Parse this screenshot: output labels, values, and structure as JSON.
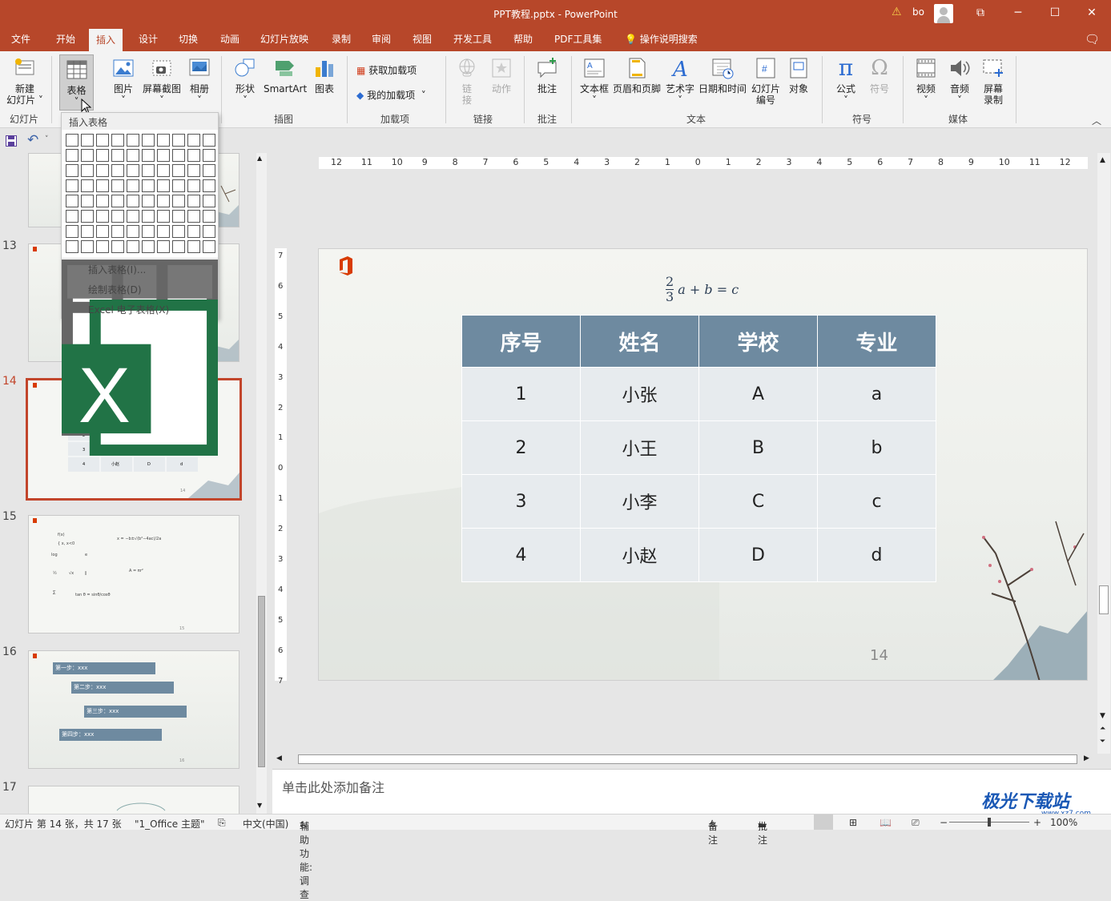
{
  "window": {
    "title": "PPT教程.pptx - PowerPoint",
    "user": "bo",
    "minimize": "─",
    "maximize": "☐",
    "close": "✕",
    "restore": "⧉"
  },
  "tabs": [
    "文件",
    "开始",
    "插入",
    "设计",
    "切换",
    "动画",
    "幻灯片放映",
    "录制",
    "审阅",
    "视图",
    "开发工具",
    "帮助",
    "PDF工具集",
    "操作说明搜索"
  ],
  "active_tab": "插入",
  "ribbon": {
    "new_slide": "新建\n幻灯片",
    "new_slide_l1": "新建",
    "new_slide_l2": "幻灯片",
    "table": "表格",
    "picture": "图片",
    "screenshot": "屏幕截图",
    "album": "相册",
    "shapes": "形状",
    "smartart": "SmartArt",
    "chart": "图表",
    "get_addins": "获取加载项",
    "my_addins": "我的加载项",
    "link": "链接",
    "link_l1": "链",
    "link_l2": "接",
    "action": "动作",
    "comment": "批注",
    "textbox": "文本框",
    "header_footer": "页眉和页脚",
    "wordart": "艺术字",
    "datetime": "日期和时间",
    "slide_num_l1": "幻灯片",
    "slide_num_l2": "编号",
    "object": "对象",
    "equation": "公式",
    "symbol": "符号",
    "video": "视频",
    "audio": "音频",
    "screen_rec_l1": "屏幕",
    "screen_rec_l2": "录制",
    "groups": {
      "slides": "幻灯片",
      "illustrations": "插图",
      "addins": "加载项",
      "links": "链接",
      "comments": "批注",
      "text": "文本",
      "symbols": "符号",
      "media": "媒体"
    }
  },
  "dropdown": {
    "header": "插入表格",
    "items": [
      "插入表格(I)...",
      "绘制表格(D)",
      "Excel 电子表格(X)"
    ]
  },
  "thumbnails": {
    "numbers": [
      "13",
      "14",
      "15",
      "16",
      "17"
    ],
    "slide16_steps": [
      "第一步：xxx",
      "第二步：xxx",
      "第三步：xxx",
      "第四步：xxx"
    ],
    "page_labels": [
      "13",
      "14",
      "15",
      "16"
    ]
  },
  "slide": {
    "formula_num": "2",
    "formula_den": "3",
    "formula_rest": "a + b = c",
    "headers": [
      "序号",
      "姓名",
      "学校",
      "专业"
    ],
    "rows": [
      [
        "1",
        "小张",
        "A",
        "a"
      ],
      [
        "2",
        "小王",
        "B",
        "b"
      ],
      [
        "3",
        "小李",
        "C",
        "c"
      ],
      [
        "4",
        "小赵",
        "D",
        "d"
      ]
    ],
    "page_number": "14"
  },
  "notes_placeholder": "单击此处添加备注",
  "status": {
    "slide_info": "幻灯片 第 14 张，共 17 张",
    "theme": "\"1_Office 主题\"",
    "language": "中文(中国)",
    "accessibility": "辅助功能: 调查",
    "notes": "备注",
    "comments": "批注",
    "zoom": "100%"
  },
  "watermark": "极光下载站",
  "watermark_url": "www.xz7.com",
  "ruler_h": [
    "12",
    "11",
    "10",
    "9",
    "8",
    "7",
    "6",
    "5",
    "4",
    "3",
    "2",
    "1",
    "0",
    "1",
    "2",
    "3",
    "4",
    "5",
    "6",
    "7",
    "8",
    "9",
    "10",
    "11",
    "12"
  ],
  "ruler_v": [
    "7",
    "6",
    "5",
    "4",
    "3",
    "2",
    "1",
    "0",
    "1",
    "2",
    "3",
    "4",
    "5",
    "6",
    "7"
  ],
  "colors": {
    "accent": "#b7472a",
    "table_header": "#6e8aa0",
    "table_cell": "#e7ebee"
  }
}
